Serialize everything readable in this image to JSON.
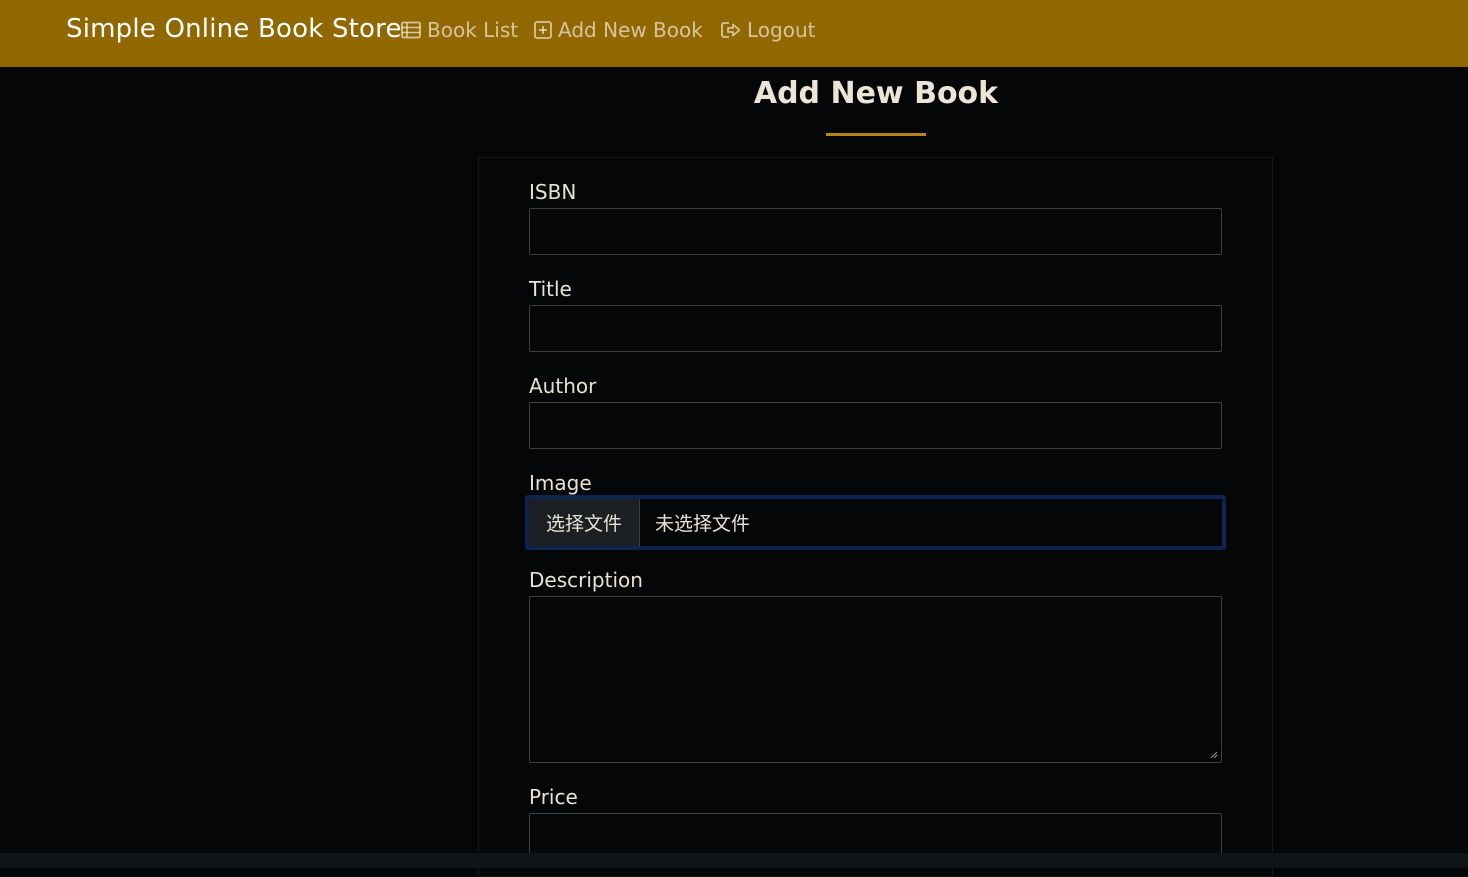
{
  "navbar": {
    "brand": "Simple Online Book Store",
    "links": [
      {
        "label": "Book List",
        "icon": "list-icon"
      },
      {
        "label": "Add New Book",
        "icon": "plus-square-icon"
      },
      {
        "label": "Logout",
        "icon": "sign-out-icon"
      }
    ]
  },
  "page": {
    "title": "Add New Book"
  },
  "form": {
    "isbn_label": "ISBN",
    "title_label": "Title",
    "author_label": "Author",
    "image_label": "Image",
    "file_button": "选择文件",
    "file_status": "未选择文件",
    "description_label": "Description",
    "price_label": "Price"
  },
  "colors": {
    "navbar": "#916800",
    "background": "#040608",
    "accent": "#b8821a"
  }
}
